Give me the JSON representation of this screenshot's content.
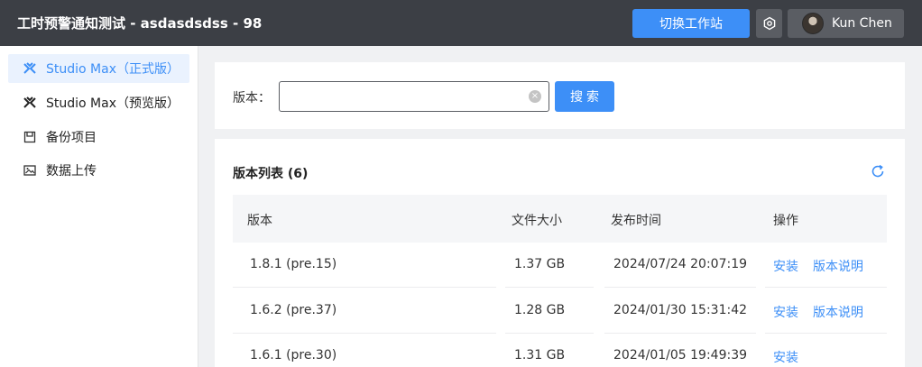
{
  "header": {
    "title": "工时预警通知测试 - asdasdsdss - 98",
    "switch_workspace": "切换工作站",
    "user_name": "Kun Chen"
  },
  "sidebar": {
    "items": [
      {
        "label": "Studio Max（正式版）",
        "icon": "studio-max-icon",
        "active": true
      },
      {
        "label": "Studio Max（预览版）",
        "icon": "studio-max-icon",
        "active": false
      },
      {
        "label": "备份项目",
        "icon": "backup-icon",
        "active": false
      },
      {
        "label": "数据上传",
        "icon": "image-upload-icon",
        "active": false
      }
    ]
  },
  "search": {
    "label": "版本：",
    "value": "",
    "placeholder": "",
    "button": "搜索"
  },
  "list": {
    "title": "版本列表 (6)",
    "columns": [
      "版本",
      "文件大小",
      "发布时间",
      "操作"
    ],
    "rows": [
      {
        "version": "1.8.1 (pre.15)",
        "size": "1.37 GB",
        "date": "2024/07/24 20:07:19",
        "install": "安装",
        "notes": "版本说明"
      },
      {
        "version": "1.6.2 (pre.37)",
        "size": "1.28 GB",
        "date": "2024/01/30 15:31:42",
        "install": "安装",
        "notes": "版本说明"
      },
      {
        "version": "1.6.1 (pre.30)",
        "size": "1.31 GB",
        "date": "2024/01/05 19:49:39",
        "install": "安装",
        "notes": ""
      }
    ]
  },
  "colors": {
    "accent": "#3d8ff7",
    "topbar": "#3c3f45",
    "active_bg": "#eaf2fe"
  }
}
